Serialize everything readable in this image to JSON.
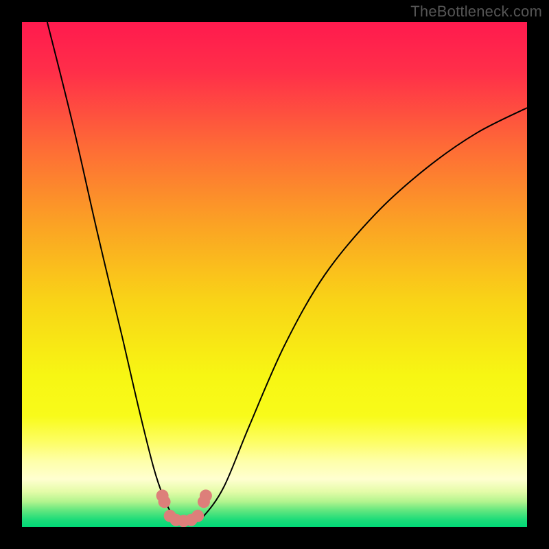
{
  "watermark": {
    "text": "TheBottleneck.com"
  },
  "chart_data": {
    "type": "line",
    "title": "",
    "xlabel": "",
    "ylabel": "",
    "x_range": [
      0,
      100
    ],
    "y_range": [
      0,
      100
    ],
    "grid": false,
    "legend": false,
    "background_gradient": {
      "direction": "vertical",
      "stops": [
        {
          "pos": 0.0,
          "color": "#ff1a4e"
        },
        {
          "pos": 0.1,
          "color": "#ff2f49"
        },
        {
          "pos": 0.25,
          "color": "#fe6c36"
        },
        {
          "pos": 0.4,
          "color": "#fba224"
        },
        {
          "pos": 0.55,
          "color": "#f9d317"
        },
        {
          "pos": 0.7,
          "color": "#f7f613"
        },
        {
          "pos": 0.78,
          "color": "#f8fb1a"
        },
        {
          "pos": 0.83,
          "color": "#fdfe62"
        },
        {
          "pos": 0.87,
          "color": "#feffaa"
        },
        {
          "pos": 0.905,
          "color": "#ffffd0"
        },
        {
          "pos": 0.93,
          "color": "#e4fca8"
        },
        {
          "pos": 0.95,
          "color": "#b1f48e"
        },
        {
          "pos": 0.965,
          "color": "#6be880"
        },
        {
          "pos": 0.985,
          "color": "#1edc79"
        },
        {
          "pos": 1.0,
          "color": "#00d977"
        }
      ]
    },
    "series": [
      {
        "name": "bottleneck-curve",
        "color": "#000000",
        "stroke_width": 2,
        "x": [
          5,
          10,
          15,
          20,
          23,
          26,
          28,
          30,
          32,
          34,
          36,
          40,
          45,
          52,
          60,
          70,
          80,
          90,
          100
        ],
        "values": [
          100,
          80,
          58,
          37,
          24,
          12,
          6,
          2.2,
          1.3,
          1.3,
          2.2,
          8,
          20,
          36,
          50,
          62,
          71,
          78,
          83
        ]
      },
      {
        "name": "highlight-dots",
        "type": "scatter",
        "color": "#dd7f7a",
        "marker_size": 18,
        "x": [
          27.8,
          28.2,
          29.3,
          30.5,
          32.0,
          33.5,
          34.8,
          36.0,
          36.4
        ],
        "values": [
          6.2,
          5.0,
          2.2,
          1.4,
          1.2,
          1.4,
          2.2,
          5.0,
          6.2
        ]
      }
    ]
  }
}
